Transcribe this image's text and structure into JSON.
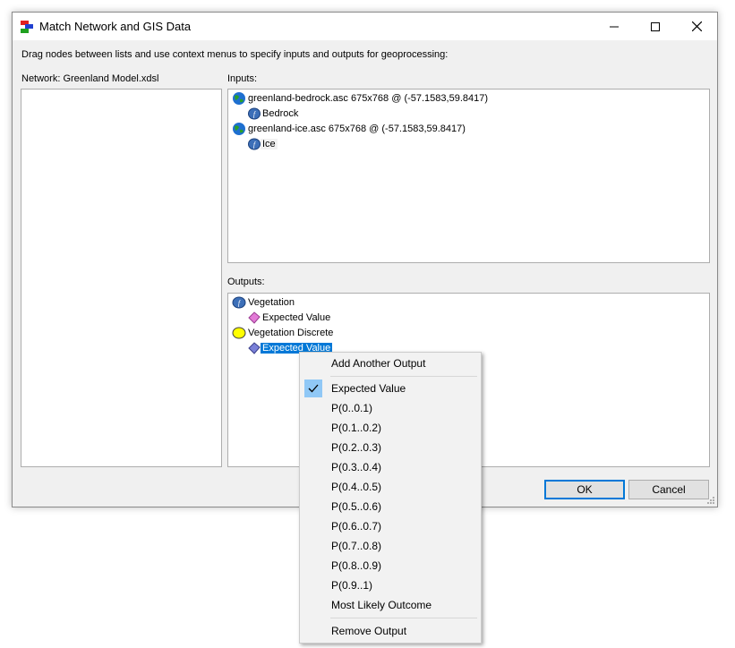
{
  "window": {
    "title": "Match Network and GIS Data",
    "instruction": "Drag nodes between lists and use context menus to specify inputs and outputs for geoprocessing:"
  },
  "network": {
    "label": "Network: Greenland Model.xdsl"
  },
  "inputs": {
    "label": "Inputs:",
    "files": [
      {
        "name": "greenland-bedrock.asc 675x768 @ (-57.1583,59.8417)",
        "child": "Bedrock"
      },
      {
        "name": "greenland-ice.asc 675x768 @ (-57.1583,59.8417)",
        "child": "Ice"
      }
    ]
  },
  "outputs": {
    "label": "Outputs:",
    "nodes": [
      {
        "name": "Vegetation",
        "child": "Expected Value"
      },
      {
        "name": "Vegetation Discrete",
        "child": "Expected Value"
      }
    ]
  },
  "buttons": {
    "ok": "OK",
    "cancel": "Cancel"
  },
  "context_menu": {
    "add": "Add Another Output",
    "items": [
      "Expected Value",
      "P(0..0.1)",
      "P(0.1..0.2)",
      "P(0.2..0.3)",
      "P(0.3..0.4)",
      "P(0.4..0.5)",
      "P(0.5..0.6)",
      "P(0.6..0.7)",
      "P(0.7..0.8)",
      "P(0.8..0.9)",
      "P(0.9..1)",
      "Most Likely Outcome"
    ],
    "checked_item": "Expected Value",
    "remove": "Remove Output"
  },
  "colors": {
    "selection": "#0078d7",
    "check_bg": "#90c8f6",
    "default_button_border": "#0078d7"
  },
  "icons": {
    "app": "network-app-icon",
    "file": "globe-icon",
    "input_node": "function-node-icon",
    "continuous_output": "function-node-icon",
    "discrete_output": "chance-node-icon",
    "value": "value-diamond-icon",
    "check": "check-icon"
  }
}
